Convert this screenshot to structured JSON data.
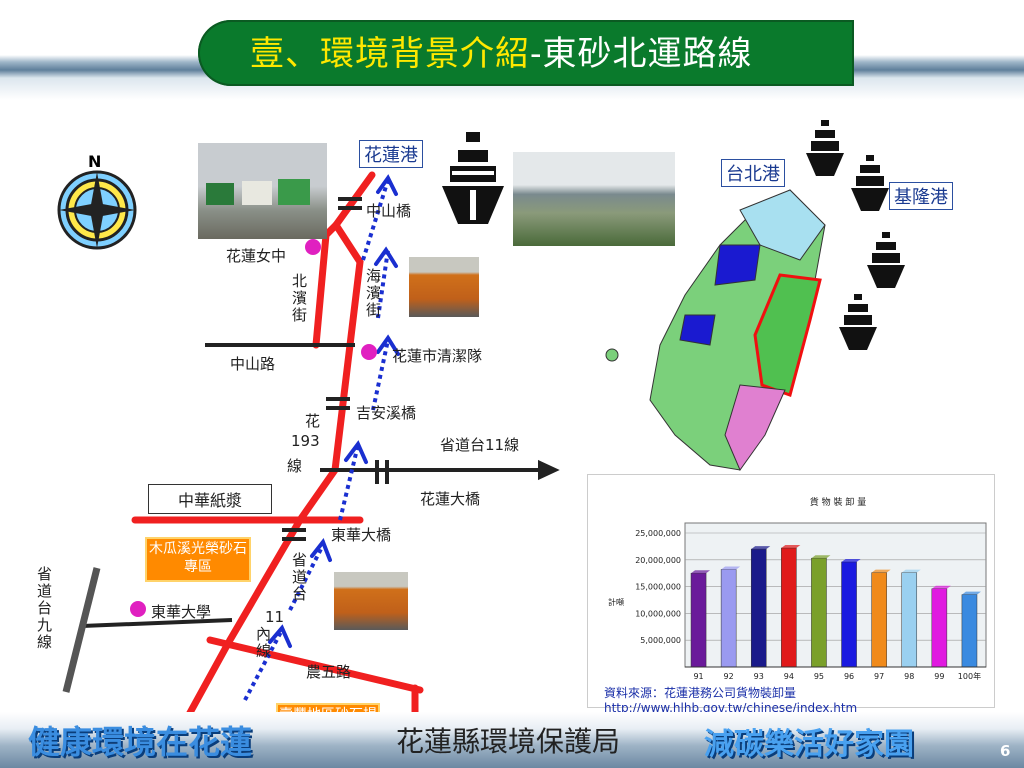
{
  "title": {
    "part1": "壹、環境背景介紹",
    "part2": "-東砂北運路線"
  },
  "map": {
    "ports": {
      "hualien": "花蓮港",
      "taipei": "台北港",
      "keelung": "基隆港"
    },
    "compass_n": "N",
    "labels": {
      "zhongshan_bridge": "中山橋",
      "girls_school": "花蓮女中",
      "beibin_st": "北濱街",
      "haibin_st": "海濱街",
      "cleaning_team": "花蓮市清潔隊",
      "zhongshan_rd": "中山路",
      "jian_bridge": "吉安溪橋",
      "hua193_a": "花",
      "hua193_b": "193",
      "hua193_c": "線",
      "tai11": "省道台11線",
      "paper": "中華紙漿",
      "hualien_bridge": "花蓮大橋",
      "mugua": "木瓜溪光榮砂石專區",
      "dong_hua_bridge": "東華大橋",
      "dhu": "東華大學",
      "tai11_v_a": "省道台",
      "tai11_v_b": "11",
      "tai11_v_c": "內線",
      "tai9": "省道台九線",
      "nongwu": "農五路",
      "shoufeng": "壽豐地區砂石場集中地"
    }
  },
  "chart_data": {
    "type": "bar",
    "title": "貨 物 裝 卸 量",
    "ylabel": "計噸",
    "xlabel": "",
    "categories": [
      "91",
      "92",
      "93",
      "94",
      "95",
      "96",
      "97",
      "98",
      "99",
      "100年"
    ],
    "values": [
      17500000,
      18200000,
      22000000,
      22200000,
      20300000,
      19600000,
      17600000,
      17600000,
      14600000,
      13500000
    ],
    "ylim": [
      0,
      25000000
    ],
    "yticks": [
      "25,000,000",
      "20,000,000",
      "15,000,000",
      "10,000,000",
      "5,000,000"
    ],
    "colors": [
      "#6a1a9a",
      "#9a9af0",
      "#1a1a8a",
      "#e01a1a",
      "#7aa02a",
      "#1a1ae0",
      "#f08a1a",
      "#9ad0f0",
      "#e01ae0",
      "#3a8ae0"
    ],
    "grid": true,
    "legend": "none"
  },
  "source": {
    "line1": "資料來源：花蓮港務公司貨物裝卸量",
    "line2": "http://www.hlhb.gov.tw/chinese/index.htm"
  },
  "footer": {
    "slogan_left": "健康環境在花蓮",
    "agency": "花蓮縣環境保護局",
    "slogan_right": "減碳樂活好家園",
    "page": "6"
  }
}
